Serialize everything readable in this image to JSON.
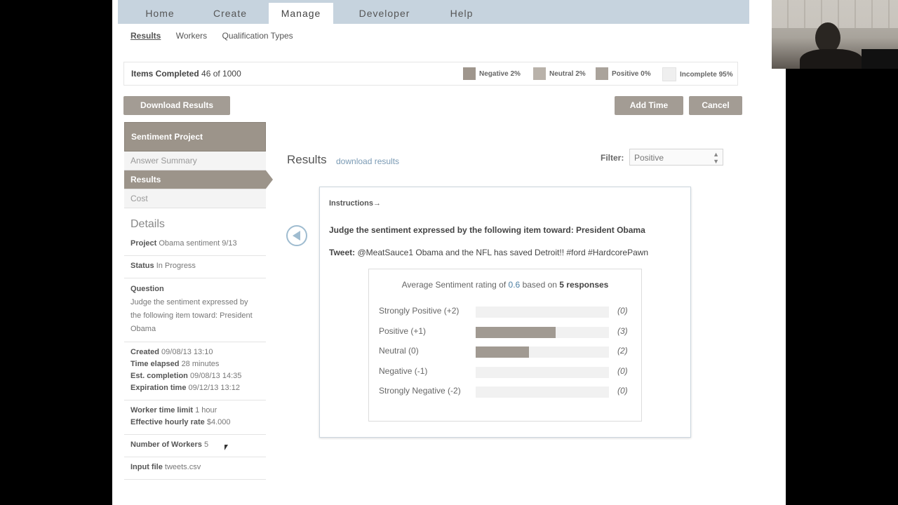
{
  "nav": {
    "tabs": [
      {
        "label": "Home"
      },
      {
        "label": "Create"
      },
      {
        "label": "Manage"
      },
      {
        "label": "Developer"
      },
      {
        "label": "Help"
      }
    ],
    "subnav": [
      "Results",
      "Workers",
      "Qualification Types"
    ]
  },
  "progress": {
    "label": "Items Completed",
    "value": "46 of 1000",
    "legend": [
      {
        "label": "Negative 2%",
        "color": "#9f968d"
      },
      {
        "label": "Neutral 2%",
        "color": "#b9b2aa"
      },
      {
        "label": "Positive 0%",
        "color": "#aaa39b"
      },
      {
        "label": "Incomplete 95%",
        "color": "#efefef"
      }
    ]
  },
  "buttons": {
    "download": "Download Results",
    "add_time": "Add Time",
    "cancel": "Cancel"
  },
  "sidebar": {
    "project": "Sentiment Project",
    "links": [
      "Answer Summary",
      "Results",
      "Cost"
    ],
    "details_title": "Details",
    "details": {
      "project_k": "Project",
      "project_v": "Obama sentiment 9/13",
      "status_k": "Status",
      "status_v": "In Progress",
      "question_k": "Question",
      "question_v": "Judge the sentiment expressed by the following item toward: President Obama",
      "created_k": "Created",
      "created_v": "09/08/13 13:10",
      "elapsed_k": "Time elapsed",
      "elapsed_v": "28 minutes",
      "est_k": "Est. completion",
      "est_v": "09/08/13 14:35",
      "exp_k": "Expiration time",
      "exp_v": "09/12/13 13:12",
      "limit_k": "Worker time limit",
      "limit_v": "1 hour",
      "rate_k": "Effective hourly rate",
      "rate_v": "$4.000",
      "workers_k": "Number of Workers",
      "workers_v": "5",
      "input_k": "Input file",
      "input_v": "tweets.csv"
    }
  },
  "main": {
    "title": "Results",
    "download_link": "download results",
    "filter_label": "Filter:",
    "filter_value": "Positive",
    "instructions": "Instructions→",
    "question": "Judge the sentiment expressed by the following item toward: President Obama",
    "tweet_label": "Tweet:",
    "tweet_text": "@MeatSauce1 Obama and the NFL has saved Detroit!! #ford #HardcorePawn",
    "avg_prefix": "Average Sentiment rating of",
    "avg_value": "0.6",
    "avg_mid": "based on",
    "avg_responses": "5 responses"
  },
  "ratings": [
    {
      "label": "Strongly Positive (+2)",
      "count": 0,
      "count_text": "(0)"
    },
    {
      "label": "Positive (+1)",
      "count": 3,
      "count_text": "(3)"
    },
    {
      "label": "Neutral (0)",
      "count": 2,
      "count_text": "(2)"
    },
    {
      "label": "Negative (-1)",
      "count": 0,
      "count_text": "(0)"
    },
    {
      "label": "Strongly Negative (-2)",
      "count": 0,
      "count_text": "(0)"
    }
  ],
  "ratings_total": 5
}
